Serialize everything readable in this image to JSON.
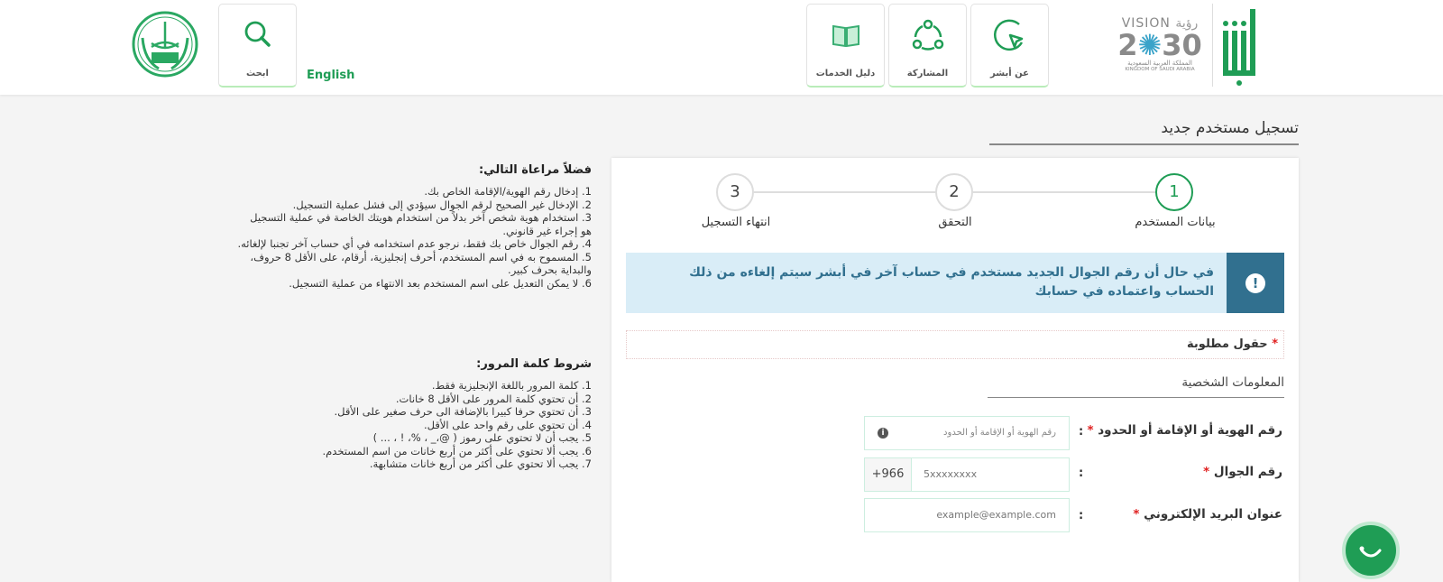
{
  "header": {
    "brand": {
      "abshir_logo": "أبشر",
      "vision_logo": "VISION رؤية 2030 المملكة العربية السعودية KINGDOM OF SAUDI ARABIA",
      "emblem": "ministry-emblem"
    },
    "nav": [
      {
        "label": "عن أبشر",
        "icon": "cursor-circle-icon"
      },
      {
        "label": "المشاركة",
        "icon": "share-icon"
      },
      {
        "label": "دليل الخدمات",
        "icon": "book-icon"
      }
    ],
    "search_label": "ابحث",
    "language_link": "English"
  },
  "colors": {
    "brand_green": "#1f9d55",
    "alert_bg": "#d9edf7",
    "alert_icon_bg": "#31708f",
    "required": "#e02020"
  },
  "page_title": "تسجيل مستخدم جديد",
  "steps": [
    {
      "number": "1",
      "label": "بيانات المستخدم",
      "active": true
    },
    {
      "number": "2",
      "label": "التحقق",
      "active": false
    },
    {
      "number": "3",
      "label": "انتهاء التسجيل",
      "active": false
    }
  ],
  "alert": {
    "text": "في حال أن رقم الجوال الجديد مستخدم في حساب آخر في أبشر سيتم إلغاءه من ذلك الحساب واعتماده في حسابك"
  },
  "required_note": "حقول مطلوبة",
  "section_title": "المعلومات الشخصية",
  "form": {
    "id_label": "رقم الهوية أو الإقامة أو الحدود",
    "id_placeholder": "رقم الهوية أو الإقامة أو الحدود",
    "mobile_label": "رقم الجوال",
    "mobile_prefix": "+966",
    "mobile_placeholder": "5xxxxxxxx",
    "email_label": "عنوان البريد الإلكتروني",
    "email_placeholder": "example@example.com",
    "colon": ":",
    "star": "*"
  },
  "notes": {
    "title": "فضلاً مراعاة التالي:",
    "items": [
      "1. إدخال رقم الهوية/الإقامة الخاص بك.",
      "2. الإدخال غير الصحيح لرقم الجوال سيؤدي إلى فشل عملية التسجيل.",
      "3. استخدام هوية شخص آخر بدلاً من استخدام هويتك الخاصة في عملية التسجيل هو إجراء غير قانوني.",
      "4. رقم الجوال خاص بك فقط، نرجو عدم استخدامه في أي حساب آخر تجنبا لإلغائه.",
      "5. المسموح به في اسم المستخدم، أحرف إنجليزية، أرقام، على الأقل 8 حروف، والبداية بحرف كبير.",
      "6. لا يمكن التعديل على اسم المستخدم بعد الانتهاء من عملية التسجيل."
    ]
  },
  "password_rules": {
    "title": "شروط كلمة المرور:",
    "items": [
      "1. كلمة المرور باللغة الإنجليزية فقط.",
      "2. أن تحتوي كلمة المرور على الأقل 8 خانات.",
      "3. أن تحتوي حرفا كبيرا بالإضافة الى حرف صغير على الأقل.",
      "4. أن تحتوي على رقم واحد على الأقل.",
      "5. يجب أن لا تحتوي على رموز ( @،_ ، %، ! ، ... )",
      "6. يجب ألا تحتوي على أكثر من أربع خانات من اسم المستخدم.",
      "7. يجب ألا تحتوي على أكثر من أربع خانات متشابهة."
    ]
  }
}
